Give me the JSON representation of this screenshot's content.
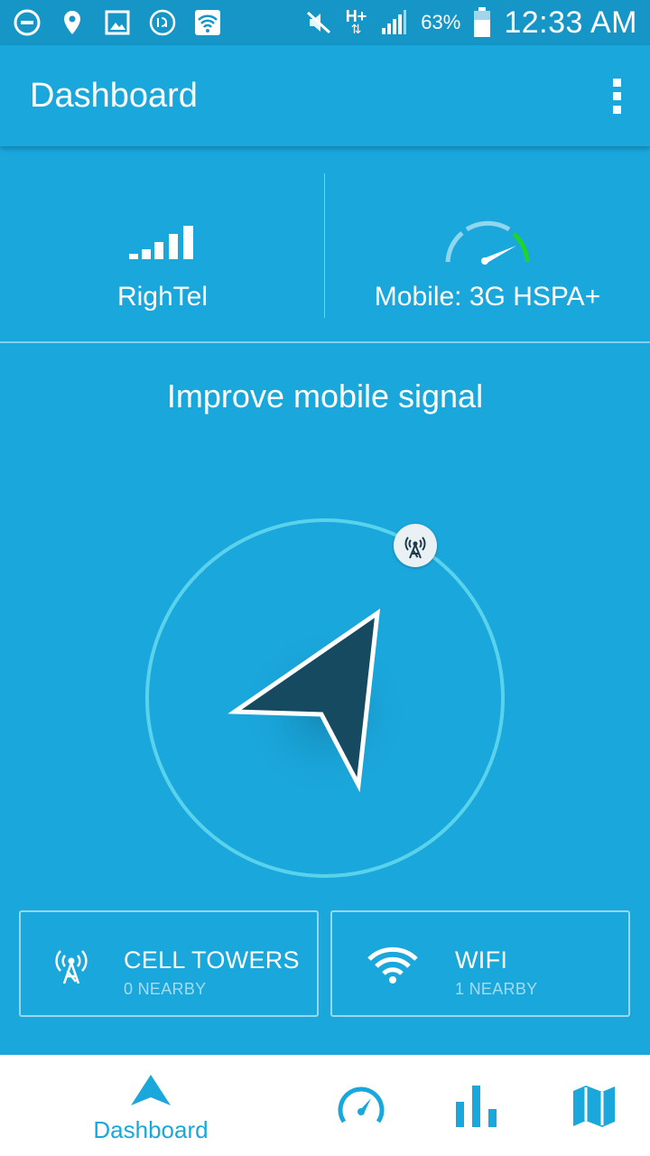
{
  "status_bar": {
    "battery_percent": "63%",
    "time": "12:33 AM",
    "network_type": "H+"
  },
  "app_bar": {
    "title": "Dashboard"
  },
  "info": {
    "carrier": "RighTel",
    "connection": "Mobile: 3G HSPA+"
  },
  "main": {
    "heading": "Improve mobile signal"
  },
  "cards": {
    "towers": {
      "title": "CELL TOWERS",
      "subtitle": "0 NEARBY"
    },
    "wifi": {
      "title": "WIFI",
      "subtitle": "1 NEARBY"
    }
  },
  "bottom_nav": {
    "dashboard_label": "Dashboard"
  },
  "colors": {
    "background": "#1aa7dc",
    "status_bar": "#1596c7",
    "arrow": "#154a60",
    "ring": "#59d3ec",
    "gauge_accent": "#1fd52b"
  }
}
